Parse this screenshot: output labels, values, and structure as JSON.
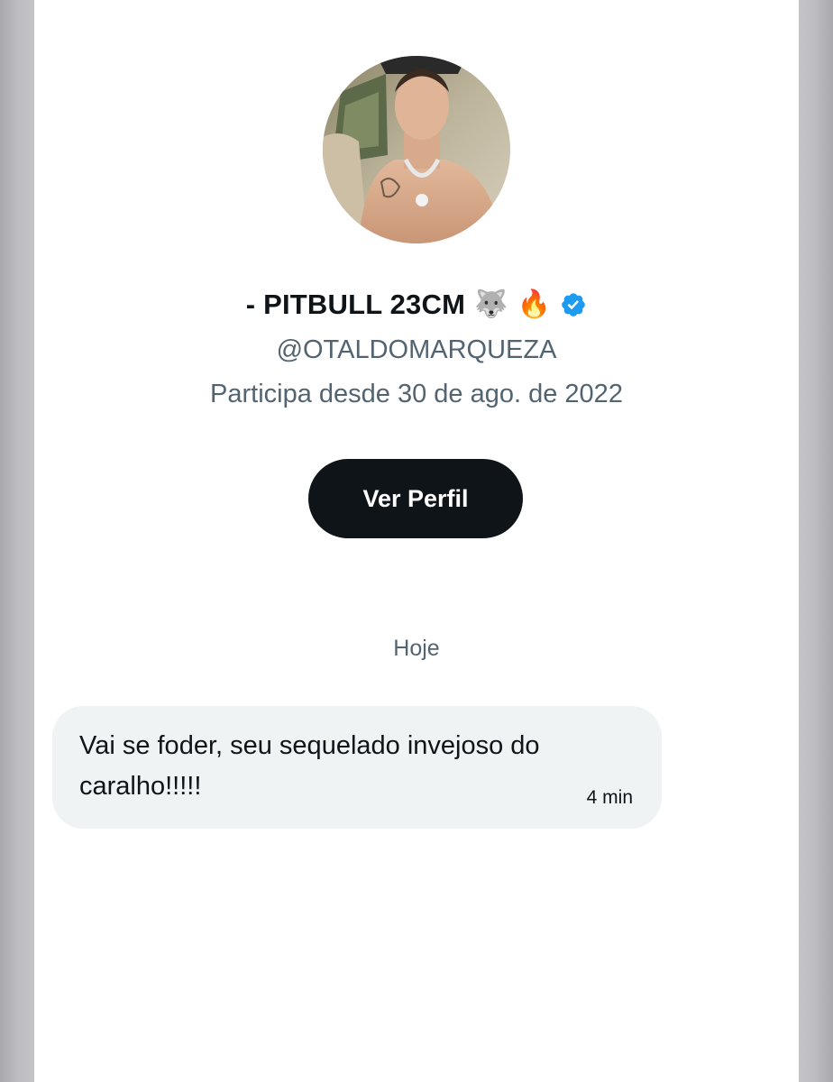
{
  "profile": {
    "display_name": "- PITBULL 23CM",
    "name_emoji_1": "🐺",
    "name_emoji_2": "🔥",
    "verified_icon": "verified-badge-icon",
    "handle": "@OTALDOMARQUEZA",
    "joined": "Participa desde 30 de ago. de 2022",
    "view_profile_label": "Ver Perfil"
  },
  "conversation": {
    "date_separator": "Hoje",
    "messages": [
      {
        "text": "Vai se foder, seu sequelado invejoso do caralho!!!!!",
        "time": "4 min"
      }
    ]
  },
  "colors": {
    "text_primary": "#0f1419",
    "text_secondary": "#536471",
    "button_bg": "#0f1419",
    "bubble_bg": "#eff3f4",
    "verified_blue": "#1d9bf0"
  }
}
